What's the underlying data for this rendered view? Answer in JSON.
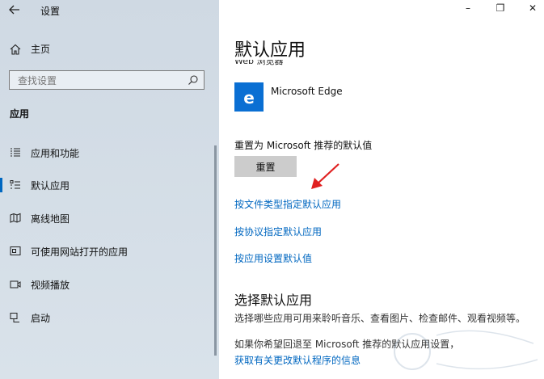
{
  "window": {
    "title": "设置",
    "minimize_glyph": "–",
    "maximize_glyph": "❐",
    "close_glyph": "✕"
  },
  "sidebar": {
    "home_label": "主页",
    "search_placeholder": "查找设置",
    "section": "应用",
    "items": [
      {
        "label": "应用和功能",
        "icon": "apps-list-icon"
      },
      {
        "label": "默认应用",
        "icon": "default-apps-icon",
        "active": true
      },
      {
        "label": "离线地图",
        "icon": "offline-maps-icon"
      },
      {
        "label": "可使用网站打开的应用",
        "icon": "apps-for-websites-icon"
      },
      {
        "label": "视频播放",
        "icon": "video-playback-icon"
      },
      {
        "label": "启动",
        "icon": "startup-icon"
      }
    ]
  },
  "main": {
    "title": "默认应用",
    "web_browser_label": "Web 浏览器",
    "browser_name": "Microsoft Edge",
    "reset_label": "重置为 Microsoft 推荐的默认值",
    "reset_button": "重置",
    "links": [
      "按文件类型指定默认应用",
      "按协议指定默认应用",
      "按应用设置默认值"
    ],
    "choose_heading": "选择默认应用",
    "choose_desc": "选择哪些应用可用来聆听音乐、查看图片、检查邮件、观看视频等。",
    "rollback_text": "如果你希望回退至 Microsoft 推荐的默认应用设置，",
    "more_info_link": "获取有关更改默认程序的信息"
  },
  "colors": {
    "accent": "#0067c0",
    "edge_tile": "#0a6fd3",
    "arrow": "#e02020"
  }
}
